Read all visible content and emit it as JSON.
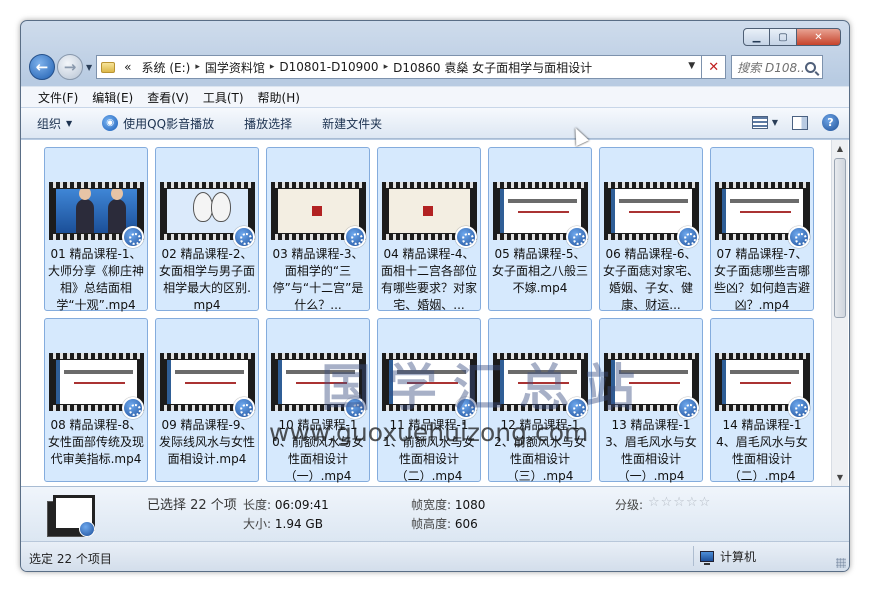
{
  "window": {
    "caption_buttons": {
      "minimize": "▁",
      "maximize": "▢",
      "close": "✕"
    }
  },
  "nav": {
    "back_icon": "arrow-left-icon",
    "forward_icon": "arrow-right-icon",
    "dropdown_glyph": "▼",
    "breadcrumbs": [
      "系统 (E:)",
      "国学资料馆",
      "D10801-D10900",
      "D10860 袁燊 女子面相学与面相设计"
    ],
    "overflow_glyph": "«",
    "separator_glyph": "▸",
    "clear_glyph": "✕",
    "search_placeholder": "搜索 D108..."
  },
  "menu": [
    "文件(F)",
    "编辑(E)",
    "查看(V)",
    "工具(T)",
    "帮助(H)"
  ],
  "toolbar": {
    "organize": "组织",
    "play_qq": "使用QQ影音播放",
    "play_selection": "播放选择",
    "new_folder": "新建文件夹",
    "help_glyph": "?"
  },
  "files": [
    {
      "name": "01 精品课程-1、大师分享《柳庄神相》总结面相学“十观”.mp4",
      "thumb": "blue"
    },
    {
      "name": "02 精品课程-2、女面相学与男子面相学最大的区别.mp4",
      "thumb": "sketch"
    },
    {
      "name": "03 精品课程-3、面相学的“三停”与“十二宫”是什么？...",
      "thumb": "book"
    },
    {
      "name": "04 精品课程-4、面相十二宫各部位有哪些要求？对家宅、婚姻、...",
      "thumb": "book"
    },
    {
      "name": "05 精品课程-5、女子面相之八般三不嫁.mp4",
      "thumb": "slide"
    },
    {
      "name": "06 精品课程-6、女子面痣对家宅、婚姻、子女、健康、财运...",
      "thumb": "slide"
    },
    {
      "name": "07 精品课程-7、女子面痣哪些吉哪些凶？如何趋吉避凶？.mp4",
      "thumb": "slide"
    },
    {
      "name": "08 精品课程-8、女性面部传统及现代审美指标.mp4",
      "thumb": "slide"
    },
    {
      "name": "09 精品课程-9、发际线风水与女性面相设计.mp4",
      "thumb": "slide"
    },
    {
      "name": "10 精品课程-10、前额风水与女性面相设计（一）.mp4",
      "thumb": "slide"
    },
    {
      "name": "11 精品课程-11、前额风水与女性面相设计（二）.mp4",
      "thumb": "slide"
    },
    {
      "name": "12 精品课程-12、前额风水与女性面相设计（三）.mp4",
      "thumb": "slide"
    },
    {
      "name": "13 精品课程-13、眉毛风水与女性面相设计（一）.mp4",
      "thumb": "slide"
    },
    {
      "name": "14 精品课程-14、眉毛风水与女性面相设计（二）.mp4",
      "thumb": "slide"
    }
  ],
  "details": {
    "selected": "已选择 22 个项",
    "length_label": "长度:",
    "length_value": "06:09:41",
    "size_label": "大小:",
    "size_value": "1.94 GB",
    "frame_width_label": "帧宽度:",
    "frame_width_value": "1080",
    "frame_height_label": "帧高度:",
    "frame_height_value": "606",
    "rating_label": "分级:",
    "rating_stars": "☆☆☆☆☆",
    "rating_value": 0
  },
  "status": {
    "left": "选定 22 个项目",
    "right": "计算机"
  },
  "watermark": {
    "main": "国学汇总站",
    "url": "www.guoxuehuizong.com"
  }
}
